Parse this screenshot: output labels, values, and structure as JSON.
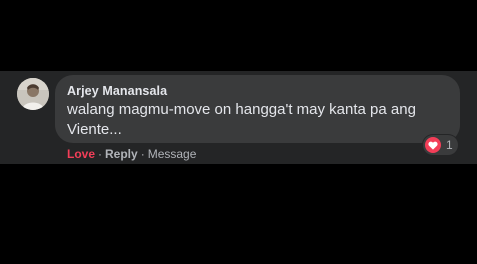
{
  "comment": {
    "author": "Arjey Manansala",
    "text": "walang magmu-move on hangga't may kanta pa ang Viente...",
    "reaction": {
      "icon": "heart-icon",
      "color": "#f33e58",
      "count": "1"
    },
    "actions": {
      "love": "Love",
      "separator": "·",
      "reply": "Reply",
      "message": "Message"
    }
  },
  "colors": {
    "background": "#000000",
    "panel": "#242526",
    "bubble": "#3a3b3c",
    "primary_text": "#e4e6eb",
    "secondary_text": "#b0b3b8",
    "love": "#f33e58"
  }
}
